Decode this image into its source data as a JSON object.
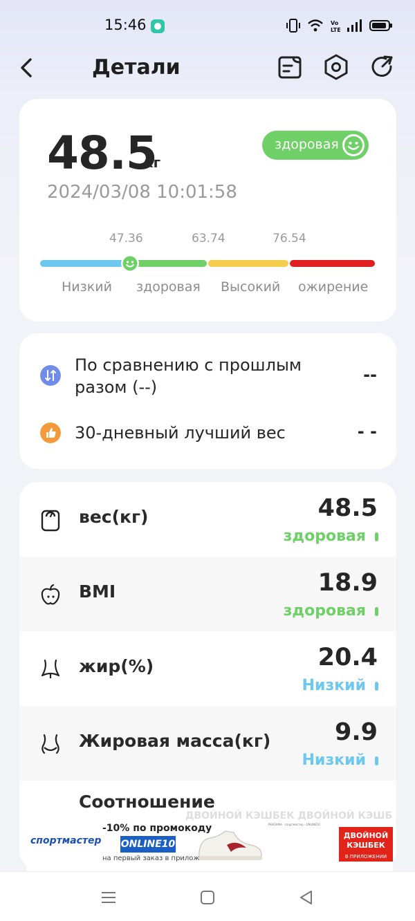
{
  "status_bar": {
    "time": "15:46",
    "network": "4G"
  },
  "header": {
    "title": "Детали",
    "icons": [
      "back-arrow-icon",
      "report-icon",
      "settings-hex-icon",
      "share-icon"
    ]
  },
  "summary": {
    "weight": "48.5",
    "unit": "кг",
    "status": "здоровая",
    "datetime": "2024/03/08 10:01:58",
    "thresholds": [
      "47.36",
      "63.74",
      "76.54"
    ],
    "ranges": [
      "Низкий",
      "здоровая",
      "Высокий",
      "ожирение"
    ],
    "colors": {
      "low": "#6cc8ee",
      "healthy": "#6fd067",
      "high": "#f6cc4d",
      "obese": "#e02020"
    }
  },
  "comparison": {
    "last_label": "По сравнению с прошлым разом (--)",
    "last_line1": "По сравнению с прошлым",
    "last_line2": "разом (--)",
    "last_value": "--",
    "best_label": "30-дневный лучший вес",
    "best_value": "- -"
  },
  "metrics": [
    {
      "label": "вес(кг)",
      "value": "48.5",
      "status": "здоровая",
      "color": "#6fd067",
      "icon": "scale-icon"
    },
    {
      "label": "BMI",
      "value": "18.9",
      "status": "здоровая",
      "color": "#6fd067",
      "icon": "apple-icon"
    },
    {
      "label": "жир(%)",
      "value": "20.4",
      "status": "Низкий",
      "color": "#6cc8ee",
      "icon": "waist-icon"
    },
    {
      "label": "Жировая масса(кг)",
      "value": "9.9",
      "status": "Низкий",
      "color": "#6cc8ee",
      "icon": "body-fat-icon"
    },
    {
      "label": "Соотношение",
      "value": "",
      "status": "",
      "color": "#6fd067",
      "icon": ""
    }
  ],
  "ad": {
    "brand": "спортмастер",
    "promo": "-10% по промокоду",
    "code": "ONLINE10",
    "sub": "на первый заказ в приложении",
    "badge_main": "ДВОЙНОЙ КЭШБЕК",
    "badge_sub": "В ПРИЛОЖЕНИИ",
    "ghost": "ДВОЙНОЙ КЭШБЕК ДВОЙНОЙ КЭШБЕК"
  },
  "nav": [
    "menu-icon",
    "home-square-icon",
    "back-triangle-icon"
  ]
}
